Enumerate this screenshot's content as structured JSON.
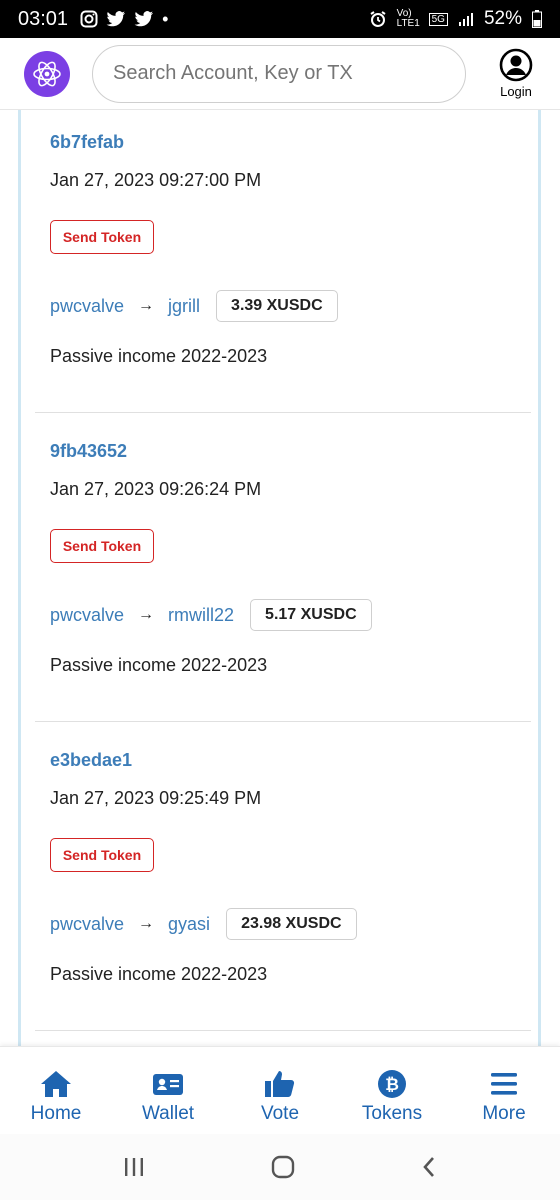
{
  "status": {
    "time": "03:01",
    "battery": "52%",
    "network": "5G",
    "carrier": "Vo) LTE1"
  },
  "header": {
    "search_placeholder": "Search Account, Key or TX",
    "login_label": "Login"
  },
  "transactions": [
    {
      "hash": "6b7fefab",
      "date": "Jan 27, 2023 09:27:00 PM",
      "type": "Send Token",
      "from": "pwcvalve",
      "to": "jgrill",
      "amount": "3.39 XUSDC",
      "memo": "Passive income 2022-2023"
    },
    {
      "hash": "9fb43652",
      "date": "Jan 27, 2023 09:26:24 PM",
      "type": "Send Token",
      "from": "pwcvalve",
      "to": "rmwill22",
      "amount": "5.17 XUSDC",
      "memo": "Passive income 2022-2023"
    },
    {
      "hash": "e3bedae1",
      "date": "Jan 27, 2023 09:25:49 PM",
      "type": "Send Token",
      "from": "pwcvalve",
      "to": "gyasi",
      "amount": "23.98 XUSDC",
      "memo": "Passive income 2022-2023"
    }
  ],
  "nav": [
    {
      "label": "Home",
      "icon": "home-icon"
    },
    {
      "label": "Wallet",
      "icon": "wallet-icon"
    },
    {
      "label": "Vote",
      "icon": "thumbs-up-icon"
    },
    {
      "label": "Tokens",
      "icon": "bitcoin-icon"
    },
    {
      "label": "More",
      "icon": "menu-icon"
    }
  ],
  "colors": {
    "accent": "#1e64b0",
    "link": "#3d7db8",
    "badge": "#d42525",
    "logo": "#7b3fe4"
  }
}
